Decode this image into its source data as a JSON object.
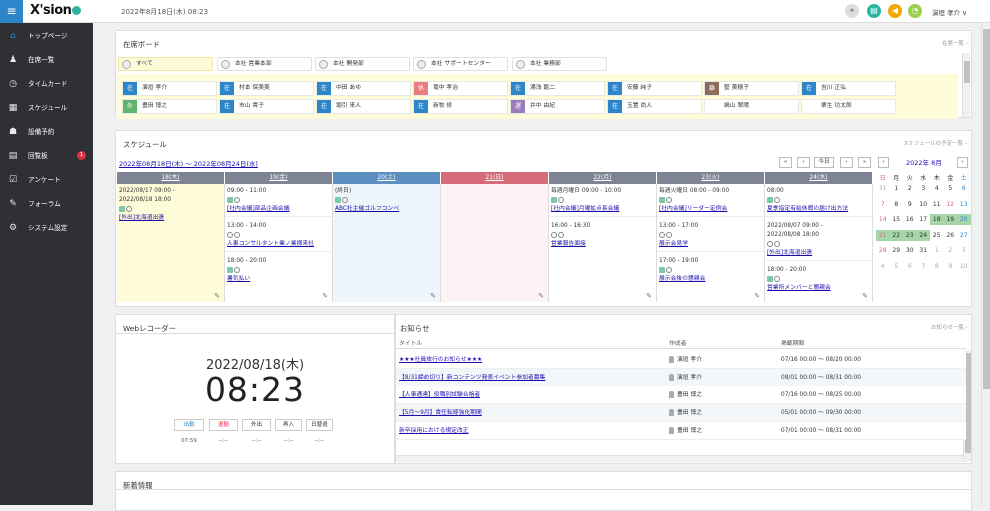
{
  "app": {
    "logo": "X'sion",
    "datetime": "2022年8月18日(木) 08:23",
    "user": "演垣 孝介"
  },
  "sidebar": {
    "items": [
      {
        "label": "トップページ",
        "icon": "house-icon",
        "glyph": "⌂"
      },
      {
        "label": "在席一覧",
        "icon": "person-icon",
        "glyph": "♟"
      },
      {
        "label": "タイムカード",
        "icon": "clock-icon",
        "glyph": "◷"
      },
      {
        "label": "スケジュール",
        "icon": "calendar-icon",
        "glyph": "▦"
      },
      {
        "label": "設備予約",
        "icon": "people-icon",
        "glyph": "☗"
      },
      {
        "label": "回覧板",
        "icon": "document-icon",
        "glyph": "▤",
        "badge": "1"
      },
      {
        "label": "アンケート",
        "icon": "checkbox-icon",
        "glyph": "☑"
      },
      {
        "label": "フォーラム",
        "icon": "chat-icon",
        "glyph": "✎"
      },
      {
        "label": "システム設定",
        "icon": "gear-icon",
        "glyph": "⚙"
      }
    ]
  },
  "presence": {
    "title": "在席ボード",
    "link": "在席一覧",
    "groups": [
      "すべて",
      "本社 営業本部",
      "本社 開発部",
      "本社 サポートセンター",
      "本社 業務部"
    ],
    "people": [
      {
        "status": "在",
        "name": "演垣 孝介",
        "color": "#2d86c9"
      },
      {
        "status": "在",
        "name": "村本 保美美",
        "color": "#2d86c9"
      },
      {
        "status": "在",
        "name": "中田 あゆ",
        "color": "#2d86c9"
      },
      {
        "status": "休",
        "name": "竜中 孝治",
        "color": "#e97e7e"
      },
      {
        "status": "在",
        "name": "湯浅 龍二",
        "color": "#2d86c9"
      },
      {
        "status": "在",
        "name": "安藤 純子",
        "color": "#2d86c9"
      },
      {
        "status": "離",
        "name": "堅 美穂子",
        "color": "#8b6c5c"
      },
      {
        "status": "在",
        "name": "吉川 正弘",
        "color": "#2d86c9"
      },
      {
        "status": "外",
        "name": "豊田 博之",
        "color": "#5fb56b"
      },
      {
        "status": "在",
        "name": "市山 貴子",
        "color": "#2d86c9"
      },
      {
        "status": "在",
        "name": "堀引 来人",
        "color": "#2d86c9"
      },
      {
        "status": "在",
        "name": "新牧 修",
        "color": "#2d86c9"
      },
      {
        "status": "遅",
        "name": "井中 由紀",
        "color": "#9c7cb8"
      },
      {
        "status": "在",
        "name": "玉置 尚人",
        "color": "#2d86c9"
      },
      {
        "status": "",
        "name": "嶋山 翠陽",
        "color": "#fff"
      },
      {
        "status": "",
        "name": "栗生 功太郎",
        "color": "#fff"
      }
    ]
  },
  "schedule": {
    "title": "スケジュール",
    "link": "スケジュールの予定一覧",
    "range": "2022年08月18日(木) 〜 2022年08月24日(水)",
    "nav": [
      "«",
      "‹",
      "今日",
      "›",
      "»"
    ],
    "days": [
      {
        "label": "18(木)",
        "color": "#7e8494",
        "bg": "#fdfbd8",
        "events": [
          {
            "time": "2022/08/17 09:00 -",
            "time2": "2022/08/18 18:00",
            "title": "[外出]北海道出張"
          }
        ]
      },
      {
        "label": "19(金)",
        "color": "#7e8494",
        "bg": "#fff",
        "events": [
          {
            "time": "09:00 - 11:00",
            "title": "[社内会議]部品企画会議"
          },
          {
            "time": "13:00 - 14:00",
            "title": "人事コンサルタント業ノ業様来社"
          },
          {
            "time": "18:00 - 20:00",
            "title": "暑気払い"
          }
        ]
      },
      {
        "label": "20(土)",
        "color": "#5b8fc2",
        "bg": "#eef5fb",
        "events": [
          {
            "time": "(終日)",
            "title": "ABC社主催ゴルフコンペ"
          }
        ]
      },
      {
        "label": "21(日)",
        "color": "#d66b7a",
        "bg": "#fdf2f4",
        "events": []
      },
      {
        "label": "22(月)",
        "color": "#7e8494",
        "bg": "#fff",
        "events": [
          {
            "time": "毎週月曜日 09:00 - 10:00",
            "title": "[社内会議]月曜拡点長会議"
          },
          {
            "time": "16:00 - 16:30",
            "title": "営業報告面接"
          }
        ]
      },
      {
        "label": "23(火)",
        "color": "#7e8494",
        "bg": "#fff",
        "events": [
          {
            "time": "毎週火曜日 08:00 - 09:00",
            "title": "[社内会議]リーダー定例会"
          },
          {
            "time": "13:00 - 17:00",
            "title": "展示会見学"
          },
          {
            "time": "17:00 - 19:00",
            "title": "展示会後の懇親会"
          }
        ]
      },
      {
        "label": "24(水)",
        "color": "#7e8494",
        "bg": "#fff",
        "events": [
          {
            "time": "08:00",
            "title": "夏季指定有給休暇の届け出方法"
          },
          {
            "time": "2022/08/07 09:00 -",
            "time2": "2022/08/08 18:00",
            "title": "[外出]北海道出張"
          },
          {
            "time": "18:00 - 20:00",
            "title": "営業所メンバーと懇親会"
          }
        ]
      }
    ],
    "mini": {
      "title": "2022年 8月",
      "weekdays": [
        "日",
        "月",
        "火",
        "水",
        "木",
        "金",
        "土"
      ],
      "weeks": [
        [
          "31",
          "1",
          "2",
          "3",
          "4",
          "5",
          "6"
        ],
        [
          "7",
          "8",
          "9",
          "10",
          "11",
          "12",
          "13"
        ],
        [
          "14",
          "15",
          "16",
          "17",
          "18",
          "19",
          "20"
        ],
        [
          "21",
          "22",
          "23",
          "24",
          "25",
          "26",
          "27"
        ],
        [
          "28",
          "29",
          "30",
          "31",
          "1",
          "2",
          "3"
        ],
        [
          "4",
          "5",
          "6",
          "7",
          "8",
          "9",
          "10"
        ]
      ]
    }
  },
  "recorder": {
    "title": "Webレコーダー",
    "date": "2022/08/18(木)",
    "time": "08:23",
    "buttons": [
      "出勤",
      "退勤",
      "外出",
      "再入",
      "日替退"
    ],
    "times": [
      "07:59",
      "--:--",
      "--:--",
      "--:--",
      "--:--"
    ]
  },
  "news": {
    "title": "お知らせ",
    "link": "お知らせ一覧",
    "cols": [
      "タイトル",
      "作成者",
      "掲載期間"
    ],
    "rows": [
      {
        "title": "★★★社員旅行のお知らせ★★★",
        "author": "演垣 孝介",
        "period": "07/16 00:00 〜 08/20 00:00"
      },
      {
        "title": "【8/31締め切り】新コンテンツ発表イベント参加者募集",
        "author": "演垣 孝介",
        "period": "08/01 00:00 〜 08/31 00:00"
      },
      {
        "title": "【人事通達】役職別試験合格者",
        "author": "豊田 博之",
        "period": "07/16 00:00 〜 08/25 00:00"
      },
      {
        "title": "【5月〜9月】責任転嫁強化期間",
        "author": "豊田 博之",
        "period": "05/01 00:00 〜 09/30 00:00"
      },
      {
        "title": "新卒採用における規定改正",
        "author": "豊田 博之",
        "period": "07/01 00:00 〜 08/31 00:00"
      }
    ]
  },
  "latest": {
    "title": "新着情報"
  }
}
